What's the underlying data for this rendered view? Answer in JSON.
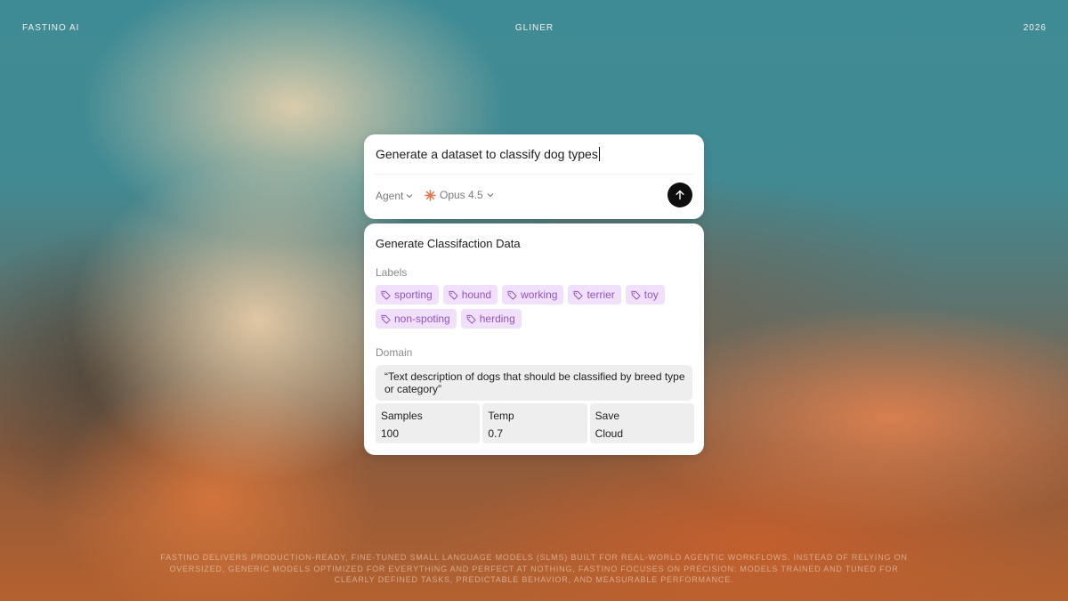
{
  "header": {
    "brand": "FASTINO AI",
    "product": "GLINER",
    "year": "2026"
  },
  "prompt": {
    "text": "Generate a dataset to classify dog types",
    "agent_label": "Agent",
    "model_label": "Opus 4.5",
    "model_icon_color": "#e8734a",
    "send_icon": "arrow-up-icon"
  },
  "data_card": {
    "title": "Generate Classifaction Data",
    "labels_heading": "Labels",
    "labels": [
      "sporting",
      "hound",
      "working",
      "terrier",
      "toy",
      "non-spoting",
      "herding"
    ],
    "domain_heading": "Domain",
    "domain_text": "“Text description of dogs that should be classified by breed type or category”",
    "params": [
      {
        "label": "Samples",
        "value": "100"
      },
      {
        "label": "Temp",
        "value": "0.7"
      },
      {
        "label": "Save",
        "value": "Cloud"
      }
    ],
    "chip_color": "#9353c2",
    "chip_bg": "#f1e0fb"
  },
  "footer": {
    "text": "FASTINO DELIVERS PRODUCTION-READY, FINE-TUNED SMALL LANGUAGE MODELS (SLMS) BUILT FOR REAL-WORLD AGENTIC WORKFLOWS. INSTEAD OF RELYING ON OVERSIZED, GENERIC MODELS OPTIMIZED FOR EVERYTHING AND PERFECT AT NOTHING, FASTINO FOCUSES ON PRECISION: MODELS TRAINED AND TUNED FOR CLEARLY DEFINED TASKS, PREDICTABLE BEHAVIOR, AND MEASURABLE PERFORMANCE."
  }
}
